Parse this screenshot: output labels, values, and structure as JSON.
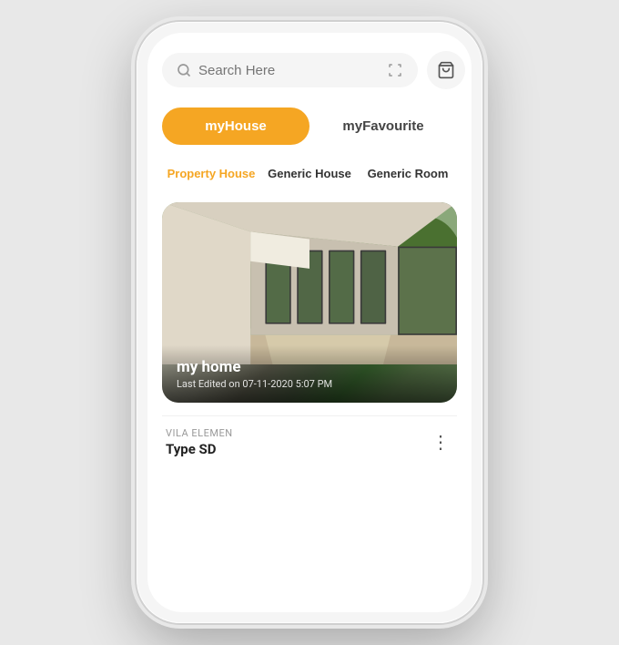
{
  "search": {
    "placeholder": "Search Here"
  },
  "mainTabs": [
    {
      "id": "myhouse",
      "label": "myHouse",
      "active": true
    },
    {
      "id": "myfavourite",
      "label": "myFavourite",
      "active": false
    }
  ],
  "subTabs": [
    {
      "id": "property-house",
      "label": "Property House",
      "active": true
    },
    {
      "id": "generic-house",
      "label": "Generic House",
      "active": false
    },
    {
      "id": "generic-room",
      "label": "Generic Room",
      "active": false
    }
  ],
  "propertyCard": {
    "title": "my home",
    "subtitle": "Last Edited on 07-11-2020 5:07 PM"
  },
  "listItem": {
    "label": "VILA ELEMEN",
    "value": "Type SD"
  },
  "colors": {
    "accent": "#F5A623",
    "activeTab": "#F5A623",
    "activeSubTab": "#F5A623"
  },
  "icons": {
    "search": "🔍",
    "bag": "🛍",
    "user": "👤",
    "scan": "⊞",
    "more": "⋮"
  }
}
